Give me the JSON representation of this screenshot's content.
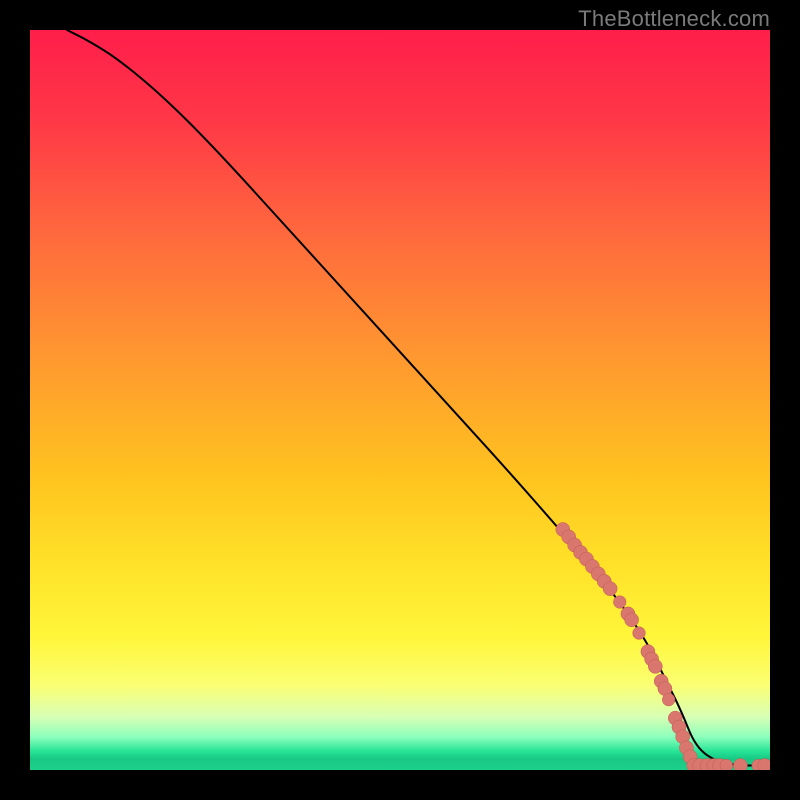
{
  "watermark": "TheBottleneck.com",
  "colors": {
    "page_bg": "#000000",
    "line": "#000000",
    "marker_fill": "#d9766e",
    "marker_stroke": "#c25a54",
    "gradient_stops": [
      {
        "offset": 0.0,
        "color": "#ff1e4b"
      },
      {
        "offset": 0.12,
        "color": "#ff3747"
      },
      {
        "offset": 0.28,
        "color": "#ff6a3d"
      },
      {
        "offset": 0.45,
        "color": "#ff9a2f"
      },
      {
        "offset": 0.6,
        "color": "#ffc21f"
      },
      {
        "offset": 0.72,
        "color": "#ffe128"
      },
      {
        "offset": 0.82,
        "color": "#fff63a"
      },
      {
        "offset": 0.885,
        "color": "#fbff73"
      },
      {
        "offset": 0.928,
        "color": "#d8ffb4"
      },
      {
        "offset": 0.955,
        "color": "#8dffbc"
      },
      {
        "offset": 0.975,
        "color": "#26e396"
      },
      {
        "offset": 0.985,
        "color": "#18c884"
      },
      {
        "offset": 1.0,
        "color": "#1dd18a"
      }
    ]
  },
  "chart_data": {
    "type": "line",
    "title": "",
    "xlabel": "",
    "ylabel": "",
    "xlim": [
      0,
      100
    ],
    "ylim": [
      0,
      100
    ],
    "series": [
      {
        "name": "bottleneck-curve",
        "x": [
          5,
          8,
          12,
          18,
          25,
          35,
          45,
          55,
          65,
          72,
          78,
          83,
          86,
          88,
          90,
          93,
          96,
          100
        ],
        "y": [
          100,
          98.5,
          96,
          91,
          84,
          73,
          62,
          51,
          40,
          32,
          25,
          18,
          12,
          8,
          3,
          1,
          0.6,
          0.6
        ]
      }
    ],
    "markers": {
      "name": "highlight-points",
      "points": [
        {
          "x": 72.0,
          "y": 32.5,
          "r": 1.0
        },
        {
          "x": 72.8,
          "y": 31.5,
          "r": 1.0
        },
        {
          "x": 73.6,
          "y": 30.4,
          "r": 1.0
        },
        {
          "x": 74.4,
          "y": 29.4,
          "r": 1.0
        },
        {
          "x": 75.2,
          "y": 28.5,
          "r": 1.0
        },
        {
          "x": 76.0,
          "y": 27.5,
          "r": 1.0
        },
        {
          "x": 76.8,
          "y": 26.5,
          "r": 1.0
        },
        {
          "x": 77.6,
          "y": 25.5,
          "r": 1.0
        },
        {
          "x": 78.4,
          "y": 24.5,
          "r": 1.0
        },
        {
          "x": 79.7,
          "y": 22.7,
          "r": 0.9
        },
        {
          "x": 80.8,
          "y": 21.1,
          "r": 1.0
        },
        {
          "x": 81.3,
          "y": 20.3,
          "r": 1.0
        },
        {
          "x": 82.3,
          "y": 18.5,
          "r": 0.9
        },
        {
          "x": 83.5,
          "y": 16.0,
          "r": 1.0
        },
        {
          "x": 84.0,
          "y": 15.0,
          "r": 1.0
        },
        {
          "x": 84.5,
          "y": 14.0,
          "r": 1.0
        },
        {
          "x": 85.3,
          "y": 12.0,
          "r": 1.0
        },
        {
          "x": 85.8,
          "y": 11.0,
          "r": 1.0
        },
        {
          "x": 86.3,
          "y": 9.5,
          "r": 0.9
        },
        {
          "x": 87.2,
          "y": 7.0,
          "r": 1.0
        },
        {
          "x": 87.7,
          "y": 5.8,
          "r": 1.0
        },
        {
          "x": 88.2,
          "y": 4.5,
          "r": 1.0
        },
        {
          "x": 88.7,
          "y": 3.0,
          "r": 1.0
        },
        {
          "x": 89.2,
          "y": 1.8,
          "r": 1.0
        },
        {
          "x": 89.7,
          "y": 0.6,
          "r": 1.0
        },
        {
          "x": 90.5,
          "y": 0.6,
          "r": 1.0
        },
        {
          "x": 91.5,
          "y": 0.6,
          "r": 1.0
        },
        {
          "x": 92.4,
          "y": 0.6,
          "r": 1.0
        },
        {
          "x": 93.2,
          "y": 0.6,
          "r": 1.0
        },
        {
          "x": 94.1,
          "y": 0.6,
          "r": 0.9
        },
        {
          "x": 96.0,
          "y": 0.6,
          "r": 1.0
        },
        {
          "x": 98.4,
          "y": 0.6,
          "r": 0.9
        },
        {
          "x": 99.3,
          "y": 0.6,
          "r": 1.0
        }
      ]
    }
  }
}
